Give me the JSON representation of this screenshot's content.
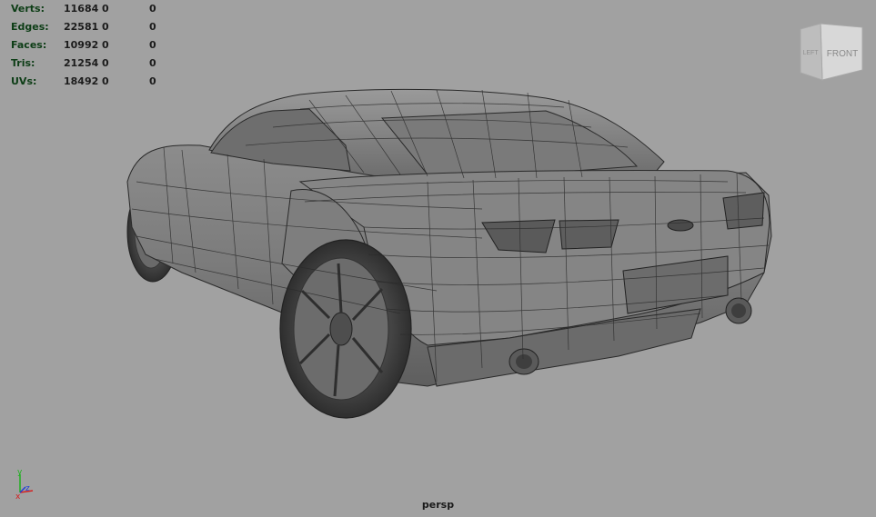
{
  "viewport": {
    "camera": "persp",
    "background": "#a1a1a1"
  },
  "hud": {
    "rows": [
      {
        "label": "Verts:",
        "total": "11684",
        "selected": "0",
        "component": "0"
      },
      {
        "label": "Edges:",
        "total": "22581",
        "selected": "0",
        "component": "0"
      },
      {
        "label": "Faces:",
        "total": "10992",
        "selected": "0",
        "component": "0"
      },
      {
        "label": "Tris:",
        "total": "21254",
        "selected": "0",
        "component": "0"
      },
      {
        "label": "UVs:",
        "total": "18492",
        "selected": "0",
        "component": "0"
      }
    ]
  },
  "viewcube": {
    "left_label": "LEFT",
    "front_label": "FRONT"
  },
  "axis": {
    "x": "x",
    "y": "y",
    "z": "z",
    "x_color": "#d42020",
    "y_color": "#20b020",
    "z_color": "#2040d8"
  }
}
